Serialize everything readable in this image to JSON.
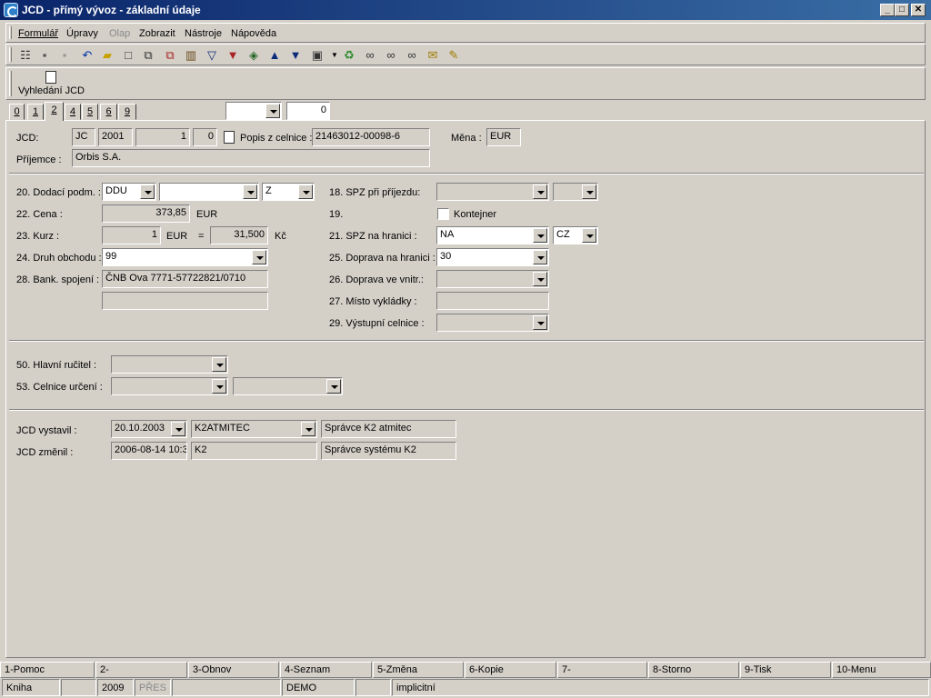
{
  "window": {
    "title": "JCD - přímý vývoz - základní údaje",
    "minimize": "_",
    "maximize": "□",
    "close": "✕"
  },
  "menu": [
    "Formulář",
    "Úpravy",
    "Olap",
    "Zobrazit",
    "Nástroje",
    "Nápověda"
  ],
  "toolbar2": {
    "search_label": "Vyhledání JCD"
  },
  "tabs": [
    "0",
    "1",
    "2",
    "4",
    "5",
    "6",
    "9"
  ],
  "tab_controls": {
    "combo_value": "",
    "number_value": "0"
  },
  "header": {
    "jcd_label": "JCD:",
    "jcd_type": "JC",
    "jcd_year": "2001",
    "jcd_num": "1",
    "jcd_sub": "0",
    "popis_label": "Popis z celnice :",
    "popis_value": "21463012-00098-6",
    "mena_label": "Měna :",
    "mena_value": "EUR",
    "prijemce_label": "Příjemce :",
    "prijemce_value": "Orbis S.A."
  },
  "left": {
    "dodaci_label": "20. Dodací podm. :",
    "dodaci_value": "DDU",
    "dodaci_value2": "",
    "dodaci_value3": "Z",
    "cena_label": "22. Cena :",
    "cena_value": "373,85",
    "cena_unit": "EUR",
    "kurz_label": "23. Kurz :",
    "kurz_value": "1",
    "kurz_cur": "EUR",
    "kurz_eq": "=",
    "kurz_rate": "31,500",
    "kurz_unit": "Kč",
    "druh_label": "24. Druh obchodu :",
    "druh_value": "99",
    "bank_label": "28. Bank. spojení :",
    "bank_value": "ČNB Ova 7771-57722821/0710",
    "bank_value2": ""
  },
  "right": {
    "spz_label": "18. SPZ při příjezdu:",
    "spz_value": "",
    "spz_value2": "",
    "f19_label": "19.",
    "kontejner_label": "Kontejner",
    "spz_hranice_label": "21. SPZ na hranici :",
    "spz_hranice_value": "NA",
    "spz_hranice_country": "CZ",
    "doprava_hranice_label": "25. Doprava na hranici :",
    "doprava_hranice_value": "30",
    "doprava_vnitr_label": "26. Doprava ve vnitr.:",
    "doprava_vnitr_value": "",
    "misto_label": "27. Místo vykládky :",
    "misto_value": "",
    "vystupni_label": "29. Výstupní celnice :",
    "vystupni_value": ""
  },
  "guarantor": {
    "rucitel_label": "50. Hlavní ručitel :",
    "rucitel_value": "",
    "celnice_label": "53. Celnice určení :",
    "celnice_value": "",
    "celnice_value2": ""
  },
  "audit": {
    "vystavil_label": "JCD vystavil :",
    "vystavil_date": "20.10.2003",
    "vystavil_user": "K2ATMITEC",
    "vystavil_name": "Správce K2 atmitec",
    "zmenil_label": "JCD změnil :",
    "zmenil_date": "2006-08-14 10:3",
    "zmenil_user": "K2",
    "zmenil_name": "Správce systému K2"
  },
  "fkeys": [
    "1-Pomoc",
    "2-",
    "3-Obnov",
    "4-Seznam",
    "5-Změna",
    "6-Kopie",
    "7-",
    "8-Storno",
    "9-Tisk",
    "10-Menu"
  ],
  "status": {
    "book": "Kniha",
    "empty1": "",
    "year": "2009",
    "pres": "PŘES",
    "empty2": "",
    "db": "DEMO",
    "empty3": "",
    "mode": "implicitní"
  },
  "icons": [
    "tree-icon",
    "save-icon",
    "save-disabled-icon",
    "save-as-icon",
    "undo-icon",
    "open-folder-icon",
    "new-document-icon",
    "copy-icon",
    "paste-icon",
    "book-icon",
    "filter-icon",
    "filter-clear-icon",
    "stack-icon",
    "arrow-up-icon",
    "arrow-down-icon",
    "camera-icon",
    "dropdown-arrow-icon",
    "recycle-icon",
    "binoculars-icon",
    "binoculars-next-icon",
    "binoculars-prev-icon",
    "envelope-icon",
    "notes-icon"
  ]
}
